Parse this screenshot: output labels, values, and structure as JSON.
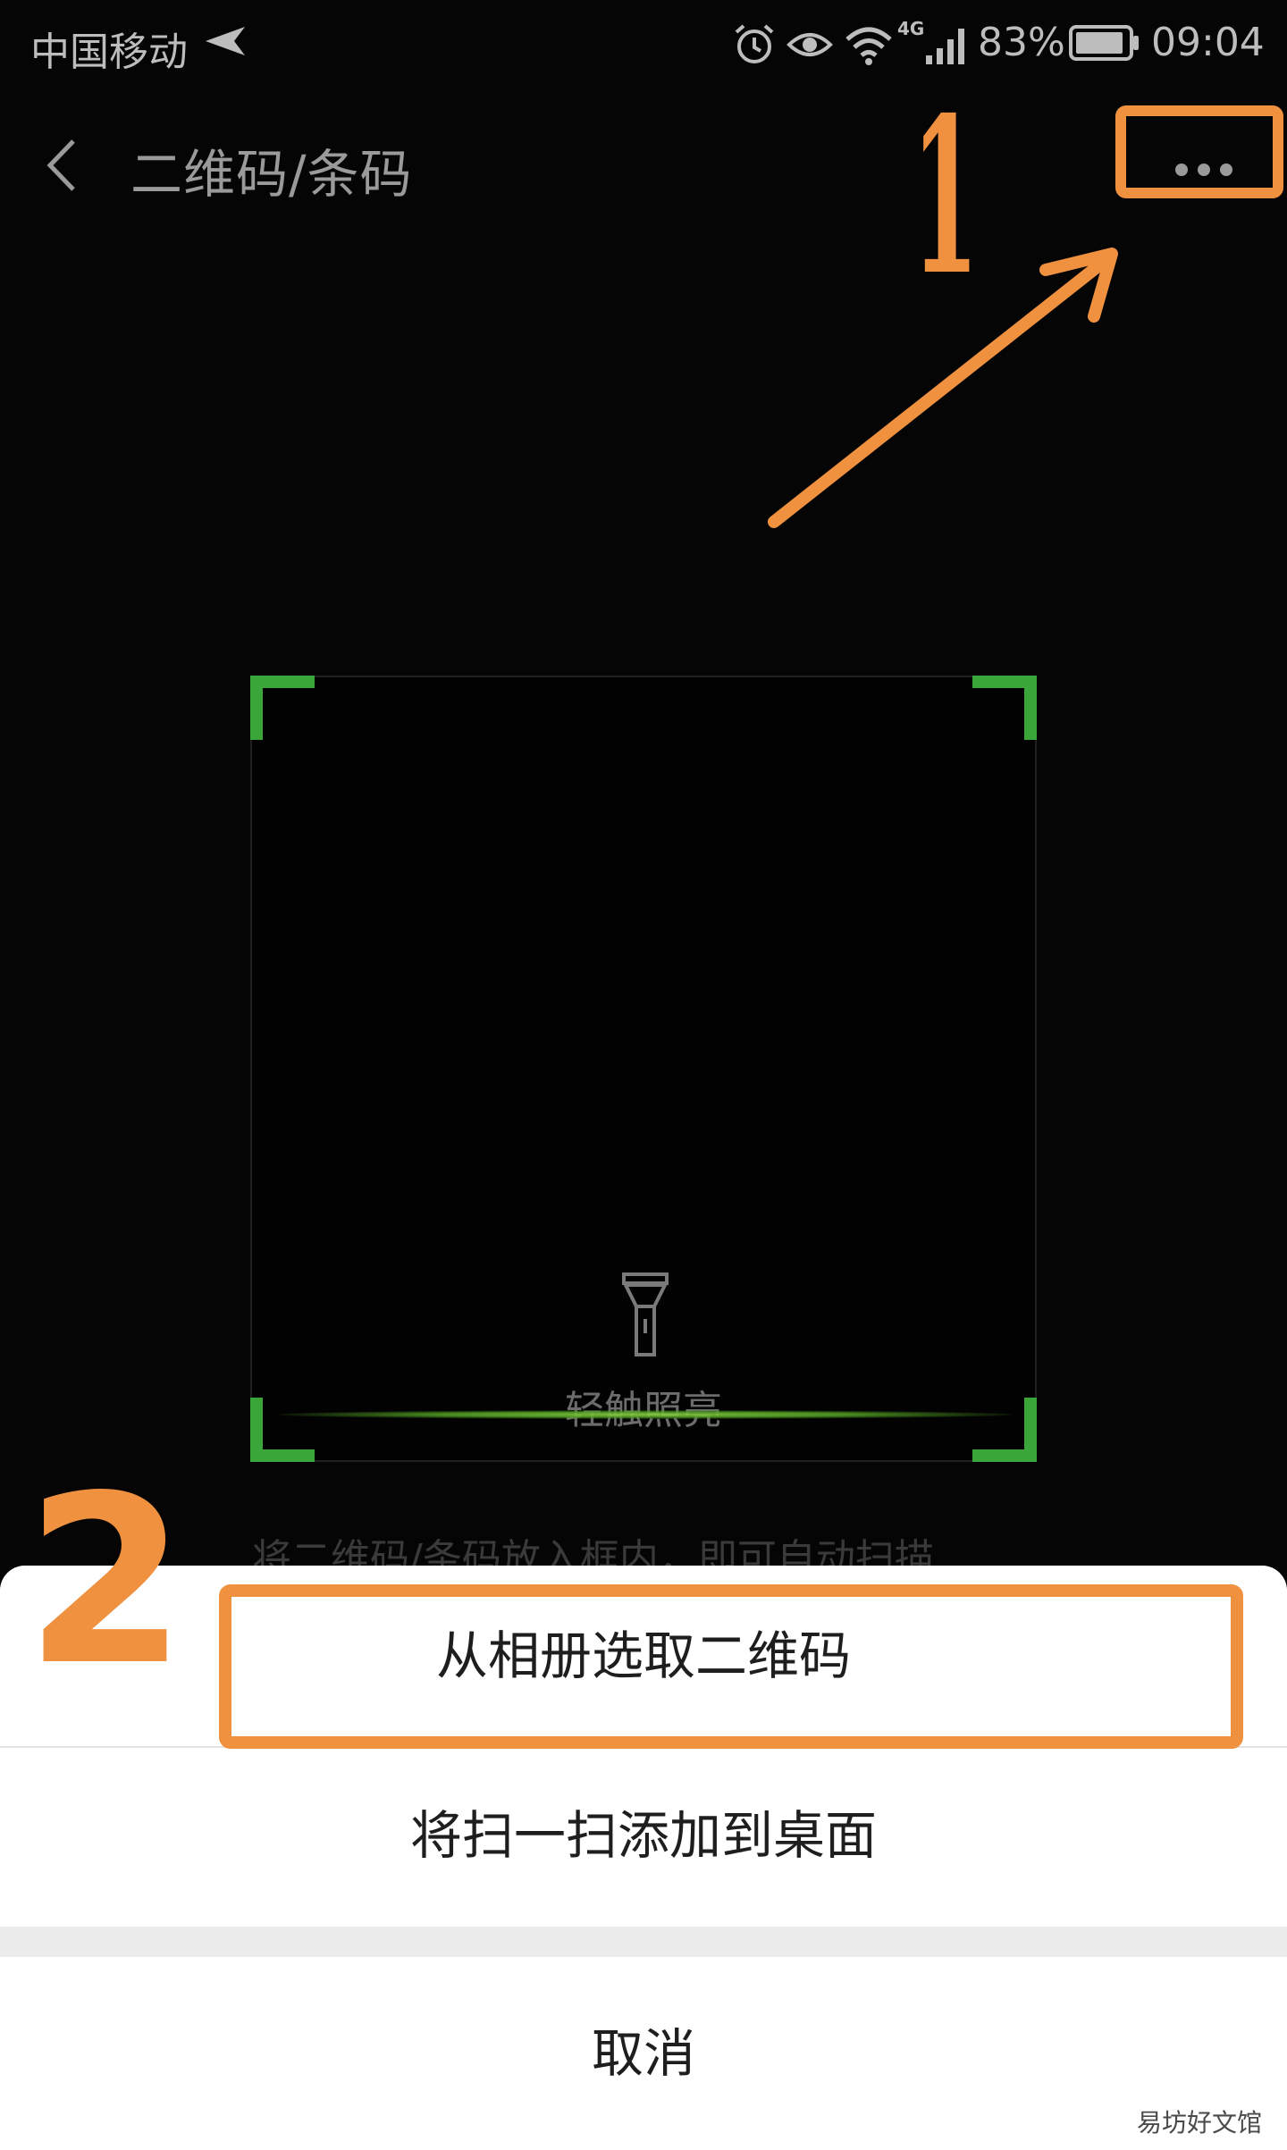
{
  "status_bar": {
    "carrier": "中国移动",
    "network_type": "4G",
    "battery_percent": "83%",
    "time": "09:04",
    "icons": [
      "signal-arrow-icon",
      "alarm-icon",
      "eye-icon",
      "wifi-icon",
      "cellular-signal-icon",
      "battery-icon"
    ]
  },
  "header": {
    "title": "二维码/条码",
    "back_icon": "chevron-left-icon",
    "more_icon": "more-dots-icon"
  },
  "scanner": {
    "flashlight_label": "轻触照亮",
    "hint": "将二维码/条码放入框内，即可自动扫描",
    "accent_color": "#3aa63a"
  },
  "sheet": {
    "items": [
      {
        "label": "从相册选取二维码"
      },
      {
        "label": "将扫一扫添加到桌面"
      },
      {
        "label": "取消"
      }
    ]
  },
  "annotations": {
    "step1": "1",
    "step2": "2",
    "color": "#f0913f"
  },
  "watermark": "易坊好文馆"
}
